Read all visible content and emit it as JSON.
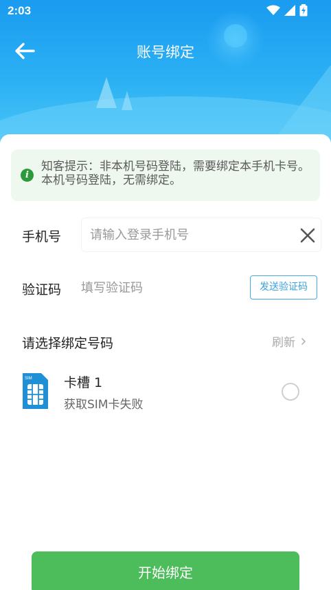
{
  "status_bar": {
    "time": "2:03"
  },
  "nav": {
    "title": "账号绑定",
    "back_icon": "arrow-left-icon"
  },
  "tip": {
    "text": "知客提示：非本机号码登陆，需要绑定本手机卡号。本机号码登陆，无需绑定。",
    "icon": "info-icon"
  },
  "phone": {
    "label": "手机号",
    "value": "",
    "placeholder": "请输入登录手机号"
  },
  "code": {
    "label": "验证码",
    "value": "",
    "placeholder": "填写验证码",
    "send_label": "发送验证码"
  },
  "select": {
    "label": "请选择绑定号码",
    "refresh_label": "刷新"
  },
  "sim_slot": {
    "title": "卡槽 1",
    "status": "获取SIM卡失败",
    "icon_text": "SIM"
  },
  "action": {
    "bind_label": "开始绑定"
  },
  "colors": {
    "header": "#1a9bf0",
    "accent_green": "#4dbd5b",
    "link_blue": "#3aa1e2",
    "tip_bg": "#eef8ef"
  }
}
